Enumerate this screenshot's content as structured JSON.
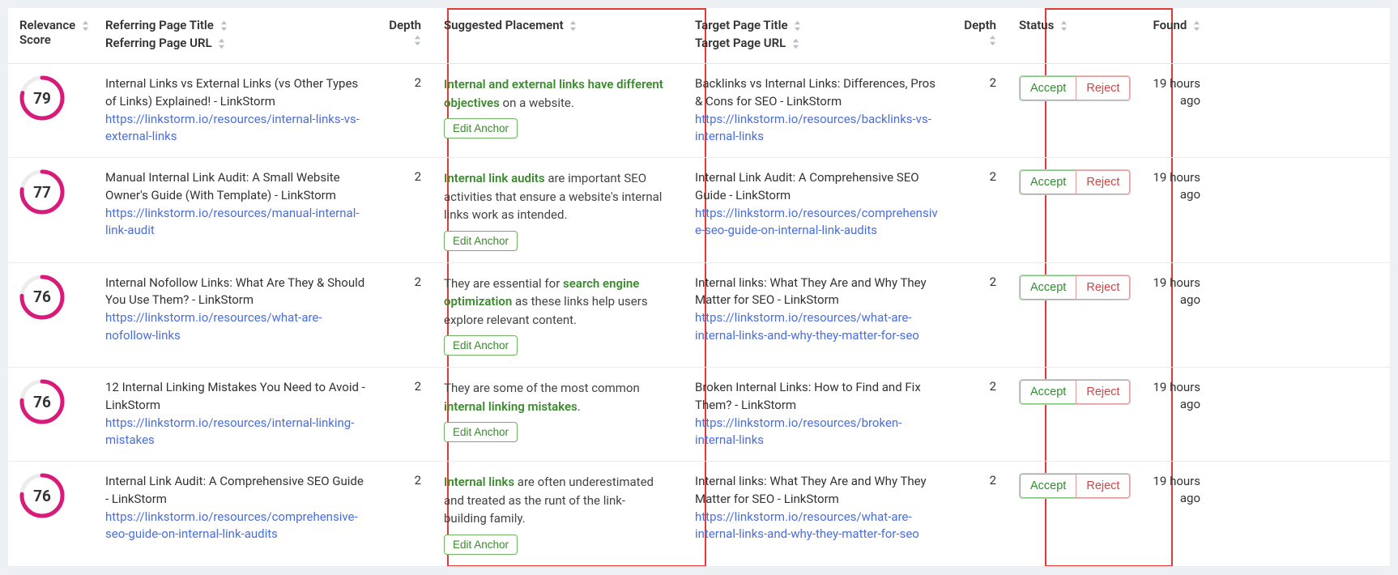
{
  "columns": {
    "relevance_l1": "Relevance",
    "relevance_l2": "Score",
    "ref_l1": "Referring Page Title",
    "ref_l2": "Referring Page URL",
    "depth": "Depth",
    "suggested": "Suggested Placement",
    "target_l1": "Target Page Title",
    "target_l2": "Target Page URL",
    "status": "Status",
    "found": "Found"
  },
  "buttons": {
    "edit_anchor": "Edit Anchor",
    "accept": "Accept",
    "reject": "Reject"
  },
  "rows": [
    {
      "score": 79,
      "ref_title": "Internal Links vs External Links (vs Other Types of Links) Explained! - LinkStorm",
      "ref_url": "https://linkstorm.io/resources/internal-links-vs-external-links",
      "depth1": 2,
      "placement_pre": "",
      "placement_anchor": "Internal and external links have different objectives",
      "placement_post": " on a website.",
      "target_title": "Backlinks vs Internal Links: Differences, Pros & Cons for SEO - LinkStorm",
      "target_url": "https://linkstorm.io/resources/backlinks-vs-internal-links",
      "depth2": 2,
      "found": "19 hours ago"
    },
    {
      "score": 77,
      "ref_title": "Manual Internal Link Audit: A Small Website Owner's Guide (With Template) - LinkStorm",
      "ref_url": "https://linkstorm.io/resources/manual-internal-link-audit",
      "depth1": 2,
      "placement_pre": "",
      "placement_anchor": "Internal link audits",
      "placement_post": " are important SEO activities that ensure a website's internal links work as intended.",
      "target_title": "Internal Link Audit: A Comprehensive SEO Guide - LinkStorm",
      "target_url": "https://linkstorm.io/resources/comprehensive-seo-guide-on-internal-link-audits",
      "depth2": 2,
      "found": "19 hours ago"
    },
    {
      "score": 76,
      "ref_title": "Internal Nofollow Links: What Are They & Should You Use Them? - LinkStorm",
      "ref_url": "https://linkstorm.io/resources/what-are-nofollow-links",
      "depth1": 2,
      "placement_pre": "They are essential for ",
      "placement_anchor": "search engine optimization",
      "placement_post": " as these links help users explore relevant content.",
      "target_title": "Internal links: What They Are and Why They Matter for SEO - LinkStorm",
      "target_url": "https://linkstorm.io/resources/what-are-internal-links-and-why-they-matter-for-seo",
      "depth2": 2,
      "found": "19 hours ago"
    },
    {
      "score": 76,
      "ref_title": "12 Internal Linking Mistakes You Need to Avoid - LinkStorm",
      "ref_url": "https://linkstorm.io/resources/internal-linking-mistakes",
      "depth1": 2,
      "placement_pre": "They are some of the most common ",
      "placement_anchor": "internal linking mistakes",
      "placement_post": ".",
      "target_title": "Broken Internal Links: How to Find and Fix Them? - LinkStorm",
      "target_url": "https://linkstorm.io/resources/broken-internal-links",
      "depth2": 2,
      "found": "19 hours ago"
    },
    {
      "score": 76,
      "ref_title": "Internal Link Audit: A Comprehensive SEO Guide - LinkStorm",
      "ref_url": "https://linkstorm.io/resources/comprehensive-seo-guide-on-internal-link-audits",
      "depth1": 2,
      "placement_pre": "",
      "placement_anchor": "Internal links",
      "placement_post": " are often underestimated and treated as the runt of the link-building family.",
      "target_title": "Internal links: What They Are and Why They Matter for SEO - LinkStorm",
      "target_url": "https://linkstorm.io/resources/what-are-internal-links-and-why-they-matter-for-seo",
      "depth2": 2,
      "found": "19 hours ago"
    }
  ]
}
